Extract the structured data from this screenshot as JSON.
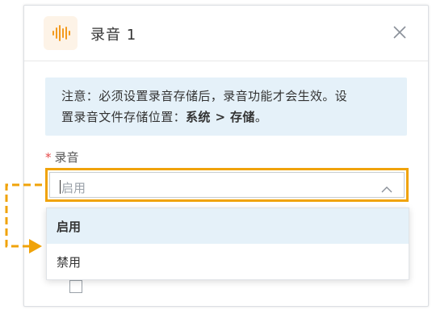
{
  "dialog": {
    "title": "录音 1"
  },
  "notice": {
    "line1": "注意：必须设置录音存储后，录音功能才会生效。设",
    "line2_prefix": "置录音文件存储位置：",
    "line2_bold": "系统 > 存储",
    "line2_suffix": "。"
  },
  "field": {
    "required_mark": "*",
    "label": "录音",
    "placeholder": "启用"
  },
  "options": [
    {
      "label": "启用",
      "selected": true
    },
    {
      "label": "禁用",
      "selected": false
    }
  ],
  "colors": {
    "highlight": "#f0a30a",
    "notice_bg": "#e5f1f9",
    "selected_bg": "#e5f1f9",
    "required": "#e64a4a"
  },
  "icons": {
    "app": "audio-waveform-icon",
    "close": "close-icon",
    "select": "chevron-up-icon"
  }
}
